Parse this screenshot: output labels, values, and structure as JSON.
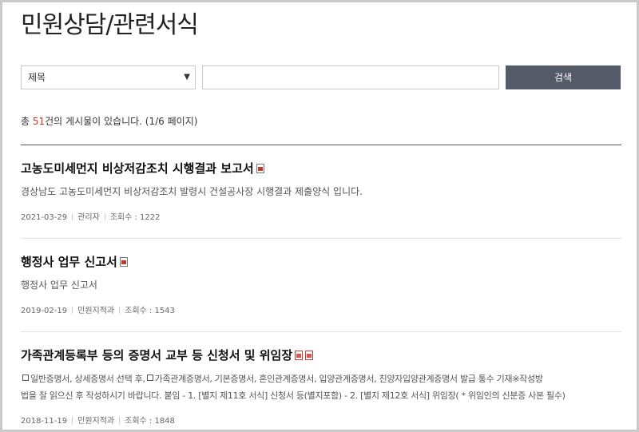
{
  "page": {
    "title": "민원상담/관련서식"
  },
  "search": {
    "select_value": "제목",
    "input_value": "",
    "button_label": "검색"
  },
  "summary": {
    "prefix": "총 ",
    "count": "51",
    "suffix": "건의 게시물이 있습니다. (1/6 페이지)"
  },
  "posts": [
    {
      "title": "고농도미세먼지 비상저감조치 시행결과 보고서",
      "attachments": [
        "hwp-icon"
      ],
      "desc": "경상남도 고농도미세먼지 비상저감조치 발령시 건설공사장 시행결과 제출양식 입니다.",
      "date": "2021-03-29",
      "author": "관리자",
      "views": "조회수 : 1222"
    },
    {
      "title": "행정사 업무 신고서",
      "attachments": [
        "hwp-icon"
      ],
      "desc": "행정사 업무 신고서",
      "date": "2019-02-19",
      "author": "민원지적과",
      "views": "조회수 : 1543"
    },
    {
      "title": "가족관계등록부 등의 증명서 교부 등 신청서 및 위임장",
      "attachments": [
        "pdf-icon",
        "pdf-icon"
      ],
      "desc_line1_a": "일반증명서, 상세증명서 선택 후,",
      "desc_line1_b": "가족관계증명서, 기본증명서, 혼인관계증명서, 입양관계증명서, 친양자입양관계증명서 발급 통수 기재※작성방",
      "desc_line2": "법을 잘 읽으신 후 작성하시기 바랍니다. 붙임 - 1. [별지 제11호 서식] 신청서 등(별지포함) - 2. [별지 제12호 서식] 위임장( * 위임인의 신분증 사본 필수)",
      "date": "2018-11-19",
      "author": "민원지적과",
      "views": "조회수 : 1848"
    }
  ]
}
